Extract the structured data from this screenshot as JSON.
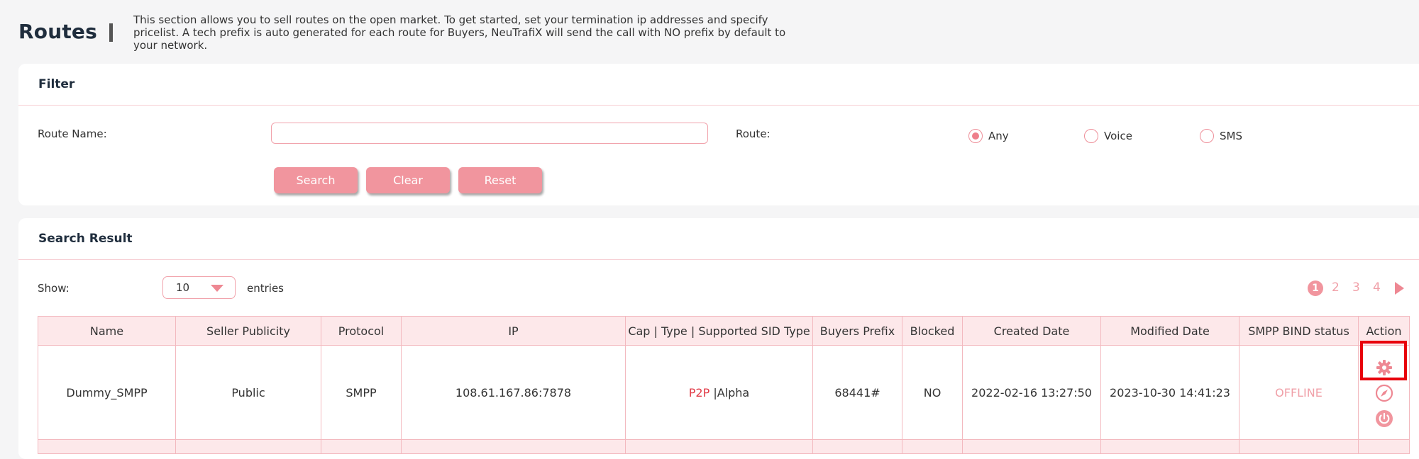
{
  "page": {
    "title": "Routes",
    "description": "This section allows you to sell routes on the open market. To get started, set your termination ip addresses and specify pricelist. A tech prefix is auto generated for each route for Buyers, NeuTrafiX will send the call with NO prefix by default to your network."
  },
  "filter": {
    "title": "Filter",
    "route_name_label": "Route Name:",
    "route_name_value": "",
    "route_label": "Route:",
    "radios": [
      {
        "label": "Any",
        "checked": true
      },
      {
        "label": "Voice",
        "checked": false
      },
      {
        "label": "SMS",
        "checked": false
      }
    ],
    "buttons": {
      "search": "Search",
      "clear": "Clear",
      "reset": "Reset"
    }
  },
  "results": {
    "title": "Search Result",
    "show_label": "Show:",
    "entries_value": "10",
    "entries_label": "entries",
    "pages": [
      "1",
      "2",
      "3",
      "4"
    ],
    "current_page": "1",
    "columns": [
      "Name",
      "Seller Publicity",
      "Protocol",
      "IP",
      "Cap | Type | Supported SID Type",
      "Buyers Prefix",
      "Blocked",
      "Created Date",
      "Modified Date",
      "SMPP BIND status",
      "Action"
    ],
    "rows": [
      {
        "name": "Dummy_SMPP",
        "publicity": "Public",
        "protocol": "SMPP",
        "ip": "108.61.167.86:7878",
        "cap": "P2P",
        "type_sep": " |",
        "sid": "Alpha",
        "prefix": "68441#",
        "blocked": "NO",
        "created": "2022-02-16 13:27:50",
        "modified": "2023-10-30 14:41:23",
        "bind_status": "OFFLINE",
        "actions": [
          "gear-icon",
          "compass-icon",
          "power-icon"
        ]
      }
    ]
  },
  "colors": {
    "accent": "#f1959e",
    "accent_dark": "#ee7f8b",
    "p2p": "#e13b47",
    "highlight": "#e8000b"
  }
}
